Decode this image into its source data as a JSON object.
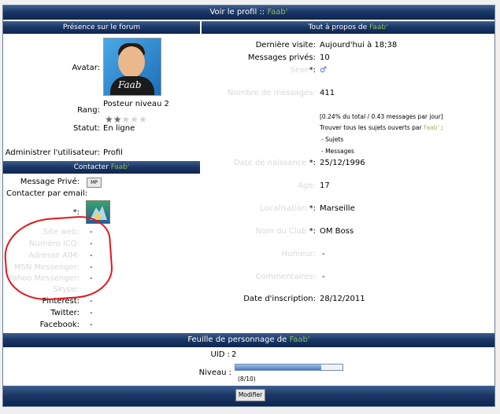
{
  "header": {
    "prefix": "Voir le profil :: ",
    "username": "Faab'"
  },
  "left": {
    "presence_title": "Présence sur le forum",
    "avatar_label": "Avatar:",
    "avatar_signature": "Faab",
    "rank_label": "Rang:",
    "rank_value": "Posteur niveau 2",
    "rank_stars": {
      "filled": 2,
      "total": 5
    },
    "status_label": "Statut:",
    "status_value": "En ligne",
    "admin_label": "Administrer l'utilisateur:",
    "admin_value": "Profil",
    "contact_title": "Contacter ",
    "contact_user": "Faab'",
    "pm_label": "Message Privé:",
    "pm_icon": "MP",
    "email_label": "Contacter par email:",
    "star_label": "*:",
    "fields": [
      {
        "label": "Site web:",
        "value": "-",
        "faded": true
      },
      {
        "label": "Numéro ICQ:",
        "value": "-",
        "faded": true
      },
      {
        "label": "Adresse AIM:",
        "value": "-",
        "faded": true
      },
      {
        "label": "MSN Messenger:",
        "value": "-",
        "faded": true
      },
      {
        "label": "Yahoo Messenger:",
        "value": "-",
        "faded": true
      },
      {
        "label": "Skype:",
        "value": "",
        "faded": true
      },
      {
        "label": "Pinterest:",
        "value": "-",
        "faded": false
      },
      {
        "label": "Twitter:",
        "value": "-",
        "faded": false
      },
      {
        "label": "Facebook:",
        "value": "-",
        "faded": false
      }
    ]
  },
  "right": {
    "about_title": "Tout à propos de ",
    "about_user": "Faab'",
    "last_visit_label": "Dernière visite:",
    "last_visit_value": "Aujourd'hui à 18;38",
    "pm_label": "Messages privés:",
    "pm_value": "10",
    "sex_label": "Sexe",
    "sex_star": "*:",
    "sex_icon": "♂",
    "msg_count_label": "Nombre de messages:",
    "msg_count_value": "411",
    "msg_stats": "[0.24% du total / 0.43 messages par jour]",
    "find_topics": "Trouver tous les sujets ouverts par ",
    "find_user": "Faab'",
    "find_suffix": " :",
    "link_subjects": "- Sujets",
    "link_messages": "- Messages",
    "birth_label": "Date de naissance",
    "birth_star": "*:",
    "birth_value": "25/12/1996",
    "age_label": "Age:",
    "age_value": "17",
    "loc_label": "Localisation",
    "loc_star": "*:",
    "loc_value": "Marseille",
    "club_label": "Nom du Club",
    "club_star": "*:",
    "club_value": "OM Boss",
    "mood_label": "Humeur:",
    "mood_value": "-",
    "comments_label": "Commentaires:",
    "comments_value": "-",
    "reg_label": "Date d'inscription:",
    "reg_value": "28/12/2011"
  },
  "character_sheet": {
    "title": "Feuille de personnage de ",
    "user": "Faab'",
    "uid_label": "UID :",
    "uid_value": "2",
    "level_label": "Niveau :",
    "level_progress": 0.8,
    "level_text": "(8/10)"
  },
  "footer": {
    "modify_label": "Modifier"
  },
  "colors": {
    "bar_dark": "#0d2550",
    "bar_light": "#3d5f8f",
    "username_green": "#8fbc5b",
    "annotation_red": "#e01818",
    "progress_blue": "#4a7cc2"
  }
}
